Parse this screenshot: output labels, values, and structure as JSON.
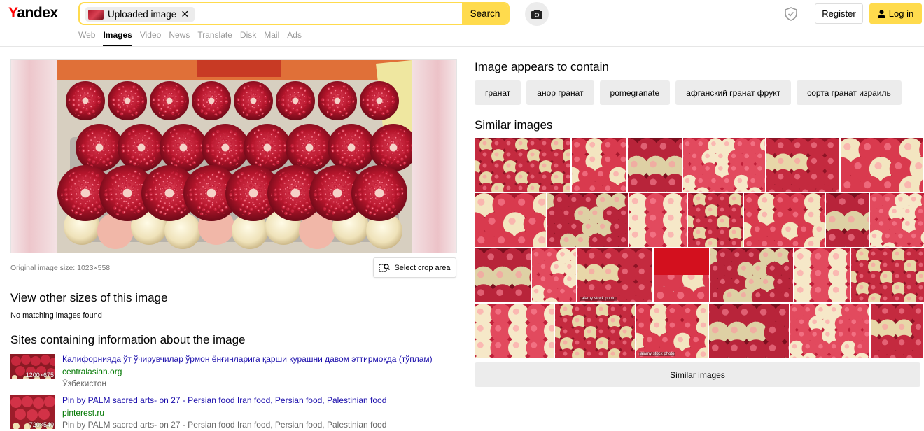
{
  "header": {
    "logo_y": "Y",
    "logo_rest": "andex",
    "search_chip_label": "Uploaded image",
    "search_chip_close": "✕",
    "search_button": "Search",
    "register_button": "Register",
    "login_button": "Log in"
  },
  "tabs": [
    {
      "label": "Web",
      "active": false
    },
    {
      "label": "Images",
      "active": true
    },
    {
      "label": "Video",
      "active": false
    },
    {
      "label": "News",
      "active": false
    },
    {
      "label": "Translate",
      "active": false
    },
    {
      "label": "Disk",
      "active": false
    },
    {
      "label": "Mail",
      "active": false
    },
    {
      "label": "Ads",
      "active": false
    }
  ],
  "preview": {
    "original_size": "Original image size: 1023×558",
    "crop_button": "Select crop area"
  },
  "other_sizes": {
    "heading": "View other sizes of this image",
    "message": "No matching images found"
  },
  "sites": {
    "heading": "Sites containing information about the image",
    "items": [
      {
        "title": "Калифорнияда ўт ўчирувчилар ўрмон ёнғинларига қарши курашни давом эттирмоқда (тўплам)",
        "domain": "centralasian.org",
        "desc": "Ўзбекистон",
        "thumb_size": "1200×675"
      },
      {
        "title": "Pin by PALM sacred arts- on 27 - Persian food Iran food, Persian food, Palestinian food",
        "domain": "pinterest.ru",
        "desc": "Pin by PALM sacred arts- on 27 - Persian food Iran food, Persian food, Palestinian food",
        "thumb_size": "720×540"
      }
    ]
  },
  "contains": {
    "heading": "Image appears to contain",
    "tags": [
      "гранат",
      "анор гранат",
      "pomegranate",
      "афганский гранат фрукт",
      "сорта гранат израиль"
    ]
  },
  "similar": {
    "heading": "Similar images",
    "button": "Similar images",
    "watermark": "alamy stock photo"
  },
  "colors": {
    "accent": "#ffdb4d",
    "link": "#1a0dab",
    "domain": "#007700",
    "pomegranate_red": "#b5152b"
  }
}
